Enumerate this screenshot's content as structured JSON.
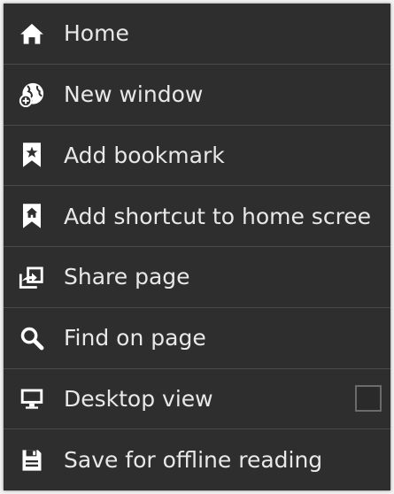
{
  "menu": {
    "items": [
      {
        "label": "Home",
        "icon": "home-icon"
      },
      {
        "label": "New window",
        "icon": "new-window-globe-icon"
      },
      {
        "label": "Add bookmark",
        "icon": "bookmark-star-icon"
      },
      {
        "label": "Add shortcut to home scree",
        "icon": "bookmark-home-icon"
      },
      {
        "label": "Share page",
        "icon": "share-icon"
      },
      {
        "label": "Find on page",
        "icon": "search-icon"
      },
      {
        "label": "Desktop view",
        "icon": "monitor-icon",
        "checkbox_checked": false
      },
      {
        "label": "Save for offline reading",
        "icon": "save-icon"
      }
    ]
  },
  "colors": {
    "background": "#2e2e2e",
    "text": "#e8e8e8",
    "divider": "#4a4a4a"
  }
}
